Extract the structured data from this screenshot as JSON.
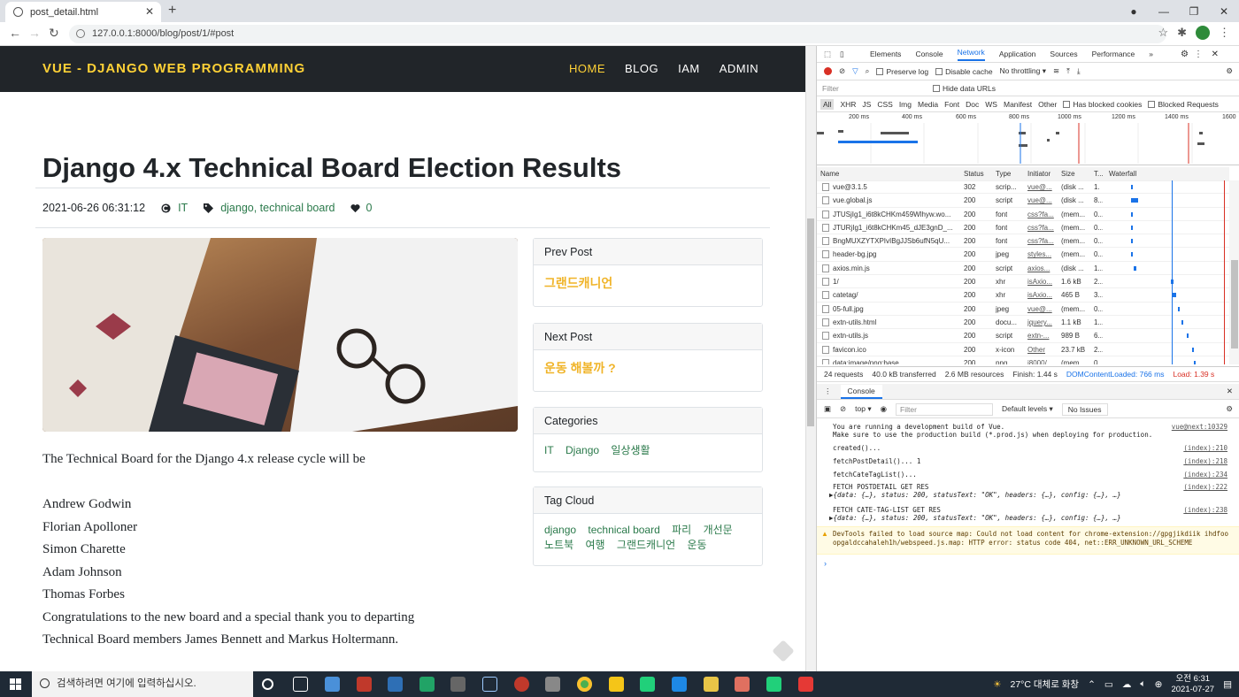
{
  "browser": {
    "tab_title": "post_detail.html",
    "url": "127.0.0.1:8000/blog/post/1/#post"
  },
  "site": {
    "brand": "VUE - DJANGO WEB PROGRAMMING",
    "menu": [
      "HOME",
      "BLOG",
      "IAM",
      "ADMIN"
    ]
  },
  "post": {
    "title": "Django 4.x Technical Board Election Results",
    "date": "2021-06-26 06:31:12",
    "category": "IT",
    "tags": "django, technical board",
    "likes": "0",
    "body": [
      "The Technical Board for the Django 4.x release cycle will be",
      "",
      "Andrew Godwin",
      "Florian Apolloner",
      "Simon Charette",
      "Adam Johnson",
      "Thomas Forbes",
      "Congratulations to the new board and a special thank you to departing",
      "Technical Board members James Bennett and Markus Holtermann."
    ]
  },
  "sidebar": {
    "prev_header": "Prev Post",
    "prev_title": "그랜드캐니언",
    "next_header": "Next Post",
    "next_title": "운동 해볼까 ?",
    "categories_header": "Categories",
    "categories": [
      "IT",
      "Django",
      "일상생활"
    ],
    "tagcloud_header": "Tag Cloud",
    "tags": [
      "django",
      "technical board",
      "파리",
      "개선문",
      "노트북",
      "여행",
      "그랜드캐니언",
      "운동"
    ]
  },
  "devtools": {
    "tabs": [
      "Elements",
      "Console",
      "Network",
      "Application",
      "Sources",
      "Performance"
    ],
    "active_tab": "Network",
    "preserve_log": "Preserve log",
    "disable_cache": "Disable cache",
    "throttling": "No throttling",
    "filter_placeholder": "Filter",
    "hide_data_urls": "Hide data URLs",
    "type_filters": [
      "All",
      "XHR",
      "JS",
      "CSS",
      "Img",
      "Media",
      "Font",
      "Doc",
      "WS",
      "Manifest",
      "Other"
    ],
    "has_blocked_cookies": "Has blocked cookies",
    "blocked_requests": "Blocked Requests",
    "timeline_ticks": [
      "200 ms",
      "400 ms",
      "600 ms",
      "800 ms",
      "1000 ms",
      "1200 ms",
      "1400 ms",
      "1600"
    ],
    "columns": [
      "Name",
      "Status",
      "Type",
      "Initiator",
      "Size",
      "T...",
      "Waterfall"
    ],
    "requests": [
      {
        "name": "vue@3.1.5",
        "status": "302",
        "type": "scrip...",
        "initiator": "vue@...",
        "size": "(disk ...",
        "time": "1."
      },
      {
        "name": "vue.global.js",
        "status": "200",
        "type": "script",
        "initiator": "vue@...",
        "size": "(disk ...",
        "time": "8..."
      },
      {
        "name": "JTUSjIg1_i6t8kCHKm459Wlhyw.wo...",
        "status": "200",
        "type": "font",
        "initiator": "css?fa...",
        "size": "(mem...",
        "time": "0..."
      },
      {
        "name": "JTURjIg1_i6t8kCHKm45_dJE3gnD_...",
        "status": "200",
        "type": "font",
        "initiator": "css?fa...",
        "size": "(mem...",
        "time": "0..."
      },
      {
        "name": "BngMUXZYTXPIvIBgJJSb6ufN5qU...",
        "status": "200",
        "type": "font",
        "initiator": "css?fa...",
        "size": "(mem...",
        "time": "0..."
      },
      {
        "name": "header-bg.jpg",
        "status": "200",
        "type": "jpeg",
        "initiator": "styles...",
        "size": "(mem...",
        "time": "0..."
      },
      {
        "name": "axios.min.js",
        "status": "200",
        "type": "script",
        "initiator": "axios...",
        "size": "(disk ...",
        "time": "1..."
      },
      {
        "name": "1/",
        "status": "200",
        "type": "xhr",
        "initiator": "isAxio...",
        "size": "1.6 kB",
        "time": "2..."
      },
      {
        "name": "catetag/",
        "status": "200",
        "type": "xhr",
        "initiator": "isAxio...",
        "size": "465 B",
        "time": "3..."
      },
      {
        "name": "05-full.jpg",
        "status": "200",
        "type": "jpeg",
        "initiator": "vue@...",
        "size": "(mem...",
        "time": "0..."
      },
      {
        "name": "extn-utils.html",
        "status": "200",
        "type": "docu...",
        "initiator": "jquery...",
        "size": "1.1 kB",
        "time": "1..."
      },
      {
        "name": "extn-utils.js",
        "status": "200",
        "type": "script",
        "initiator": "extn-...",
        "size": "989 B",
        "time": "6..."
      },
      {
        "name": "favicon.ico",
        "status": "200",
        "type": "x-icon",
        "initiator": "Other",
        "size": "23.7 kB",
        "time": "2..."
      },
      {
        "name": "data:image/png;base...",
        "status": "200",
        "type": "png",
        "initiator": "i8000/...",
        "size": "(mem...",
        "time": "0..."
      }
    ],
    "summary": {
      "requests": "24 requests",
      "transferred": "40.0 kB transferred",
      "resources": "2.6 MB resources",
      "finish": "Finish: 1.44 s",
      "domcontentloaded": "DOMContentLoaded: 766 ms",
      "load": "Load: 1.39 s"
    },
    "console_drawer_title": "Console",
    "console_context": "top",
    "console_filter": "Filter",
    "levels": "Default levels",
    "issues": "No Issues",
    "console_lines": [
      {
        "text": "You are running a development build of Vue.",
        "source": "vue@next:10329"
      },
      {
        "text": "Make sure to use the production build (*.prod.js) when deploying for production.",
        "source": ""
      },
      {
        "text": "created()...",
        "source": "(index):210"
      },
      {
        "text": "fetchPostDetail()... 1",
        "source": "(index):218"
      },
      {
        "text": "fetchCateTagList()...",
        "source": "(index):234"
      },
      {
        "text": "FETCH POSTDETAIL GET RES",
        "source": "(index):222"
      },
      {
        "text": "▶{data: {…}, status: 200, statusText: \"OK\", headers: {…}, config: {…}, …}",
        "source": ""
      },
      {
        "text": "FETCH CATE-TAG-LIST GET RES",
        "source": "(index):238"
      },
      {
        "text": "▶{data: {…}, status: 200, statusText: \"OK\", headers: {…}, config: {…}, …}",
        "source": ""
      }
    ],
    "warning": "DevTools failed to load source map: Could not load content for chrome-extension://gpgjikdiik ihdfooopgaldccahaleh1h/webspeed.js.map: HTTP error: status code 404, net::ERR_UNKNOWN_URL_SCHEME"
  },
  "taskbar": {
    "search_placeholder": "검색하려면 여기에 입력하십시오.",
    "weather": "27°C  대체로 화창",
    "time": "오전 6:31",
    "date": "2021-07-27"
  }
}
